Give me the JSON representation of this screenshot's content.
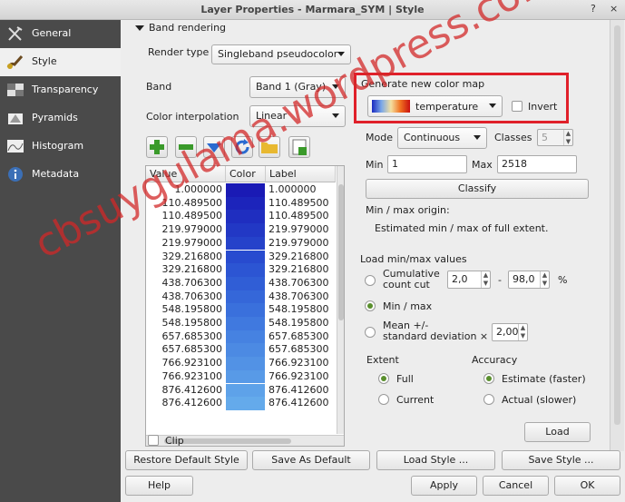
{
  "window": {
    "title": "Layer Properties - Marmara_SYM | Style",
    "help_glyph": "?",
    "close_glyph": "×"
  },
  "sidebar": {
    "items": [
      {
        "label": "General",
        "icon": "wrench-icon"
      },
      {
        "label": "Style",
        "icon": "brush-icon"
      },
      {
        "label": "Transparency",
        "icon": "transparency-icon"
      },
      {
        "label": "Pyramids",
        "icon": "pyramid-icon"
      },
      {
        "label": "Histogram",
        "icon": "histogram-icon"
      },
      {
        "label": "Metadata",
        "icon": "info-icon"
      }
    ]
  },
  "band_rendering": {
    "section_label": "Band rendering",
    "render_type_label": "Render type",
    "render_type_value": "Singleband pseudocolor",
    "band_label": "Band",
    "band_value": "Band 1 (Gray)",
    "interp_label": "Color interpolation",
    "interp_value": "Linear"
  },
  "colormap": {
    "title": "Generate new color map",
    "ramp_name": "temperature",
    "invert_label": "Invert",
    "mode_label": "Mode",
    "mode_value": "Continuous",
    "classes_label": "Classes",
    "classes_value": "5",
    "min_label": "Min",
    "min_value": "1",
    "max_label": "Max",
    "max_value": "2518",
    "classify_label": "Classify",
    "origin_label": "Min / max origin:",
    "origin_value": "Estimated min / max of full extent."
  },
  "minmax": {
    "title": "Load min/max values",
    "cumulative_label": "Cumulative\ncount cut",
    "cumulative_low": "2,0",
    "dash": "-",
    "cumulative_high": "98,0",
    "percent": "%",
    "minmax_label": "Min / max",
    "mean_label": "Mean +/-\nstandard deviation ×",
    "stddev_value": "2,00",
    "extent_title": "Extent",
    "extent_full": "Full",
    "extent_current": "Current",
    "accuracy_title": "Accuracy",
    "accuracy_estimate": "Estimate (faster)",
    "accuracy_actual": "Actual (slower)",
    "load_label": "Load"
  },
  "table": {
    "headers": [
      "Value",
      "Color",
      "Label"
    ],
    "rows": [
      {
        "value": "1.000000",
        "color": "#1a1ab5"
      },
      {
        "value": "110.489500",
        "color": "#1c24bb"
      },
      {
        "value": "110.489500",
        "color": "#1f2ec0"
      },
      {
        "value": "219.979000",
        "color": "#2238c5"
      },
      {
        "value": "219.979000",
        "color": "#2542ca"
      },
      {
        "value": "329.216800",
        "color": "#284bcf"
      },
      {
        "value": "329.216800",
        "color": "#2c55d3"
      },
      {
        "value": "438.706300",
        "color": "#305ed6"
      },
      {
        "value": "438.706300",
        "color": "#3567d9"
      },
      {
        "value": "548.195800",
        "color": "#3a70dc"
      },
      {
        "value": "548.195800",
        "color": "#4079df"
      },
      {
        "value": "657.685300",
        "color": "#4682e1"
      },
      {
        "value": "657.685300",
        "color": "#4c8ae3"
      },
      {
        "value": "766.923100",
        "color": "#5292e5"
      },
      {
        "value": "766.923100",
        "color": "#589ae7"
      },
      {
        "value": "876.412600",
        "color": "#5ea2e9"
      },
      {
        "value": "876.412600",
        "color": "#64aaeb"
      }
    ],
    "clip_label": "Clip"
  },
  "footer": {
    "restore": "Restore Default Style",
    "save_default": "Save As Default",
    "load_style": "Load Style ...",
    "save_style": "Save Style ...",
    "help": "Help",
    "apply": "Apply",
    "cancel": "Cancel",
    "ok": "OK"
  },
  "watermark": "cbsuygulama.wordpress.com",
  "colors": {
    "highlight_box": "#e0202a",
    "sidebar_bg": "#4a4a4a",
    "radio_on": "#5a8f2e"
  }
}
